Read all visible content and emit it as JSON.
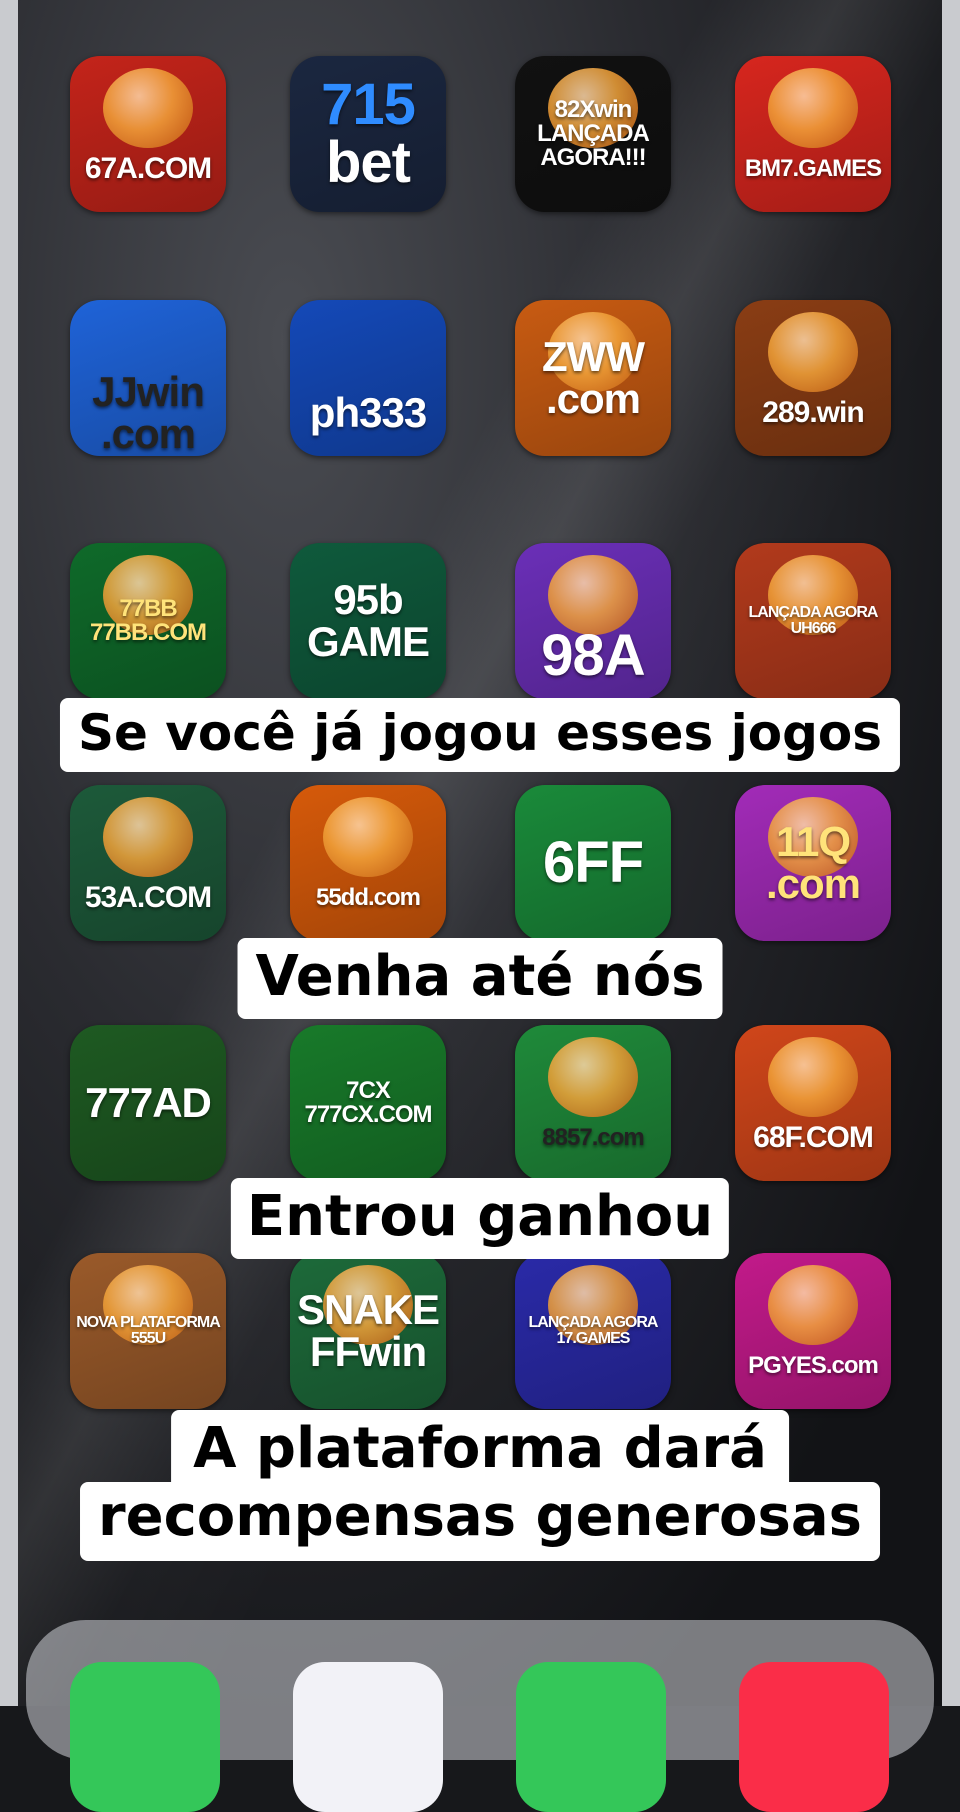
{
  "apps": [
    {
      "name": "67A.COM",
      "label": "67A.COM",
      "bg": "#c4241a",
      "fg": "#ffffff"
    },
    {
      "name": "715 bet",
      "label": "715\nbet",
      "bg": "#1b2740",
      "fg": "#ffffff",
      "accent": "#2f8cff"
    },
    {
      "name": "82Xwin",
      "label": "82Xwin\nLANÇADA\nAGORA!!!",
      "bg": "#111111",
      "fg": "#ffffff"
    },
    {
      "name": "BM7.GAMES",
      "label": "BM7.GAMES",
      "bg": "#d7261e",
      "fg": "#ffffff"
    },
    {
      "name": "JJwin",
      "label": "JJwin\n.com",
      "bg": "#1f63d8",
      "fg": "#222222"
    },
    {
      "name": "ph333",
      "label": "ph333",
      "bg": "#1449b8",
      "fg": "#ffffff"
    },
    {
      "name": "ZWW.com",
      "label": "ZWW\n.com",
      "bg": "#c85b12",
      "fg": "#ffffff"
    },
    {
      "name": "289.win",
      "label": "289.win",
      "bg": "#8a3d14",
      "fg": "#ffffff"
    },
    {
      "name": "77BB",
      "label": "77BB\n77BB.COM",
      "bg": "#0f6a2a",
      "fg": "#ffe37a"
    },
    {
      "name": "95b GAME",
      "label": "95b\nGAME",
      "bg": "#0f5a3c",
      "fg": "#ffffff"
    },
    {
      "name": "98A",
      "label": "98A",
      "bg": "#6b2fb8",
      "fg": "#ffffff"
    },
    {
      "name": "UH666",
      "label": "LANÇADA AGORA\nUH666",
      "bg": "#b23a1c",
      "fg": "#ffffff"
    },
    {
      "name": "53A.COM",
      "label": "53A.COM",
      "bg": "#1d5a3a",
      "fg": "#ffffff"
    },
    {
      "name": "55dd.com",
      "label": "55dd.com",
      "bg": "#d65a0a",
      "fg": "#ffffff"
    },
    {
      "name": "6FF",
      "label": "6FF",
      "bg": "#1a8a3a",
      "fg": "#ffffff"
    },
    {
      "name": "11Q.com",
      "label": "11Q\n.com",
      "bg": "#a22bb8",
      "fg": "#ffe37a"
    },
    {
      "name": "777AD",
      "label": "777AD",
      "bg": "#1e5a22",
      "fg": "#ffffff"
    },
    {
      "name": "777CX.COM",
      "label": "7CX\n777CX.COM",
      "bg": "#187a2a",
      "fg": "#ffffff"
    },
    {
      "name": "8857.com",
      "label": "8857.com",
      "bg": "#1f8a3a",
      "fg": "#222222"
    },
    {
      "name": "68F.COM",
      "label": "68F.COM",
      "bg": "#d0461a",
      "fg": "#ffffff"
    },
    {
      "name": "555U",
      "label": "NOVA PLATAFORMA\n555U",
      "bg": "#9a5a2a",
      "fg": "#ffffff"
    },
    {
      "name": "FFwin",
      "label": "SNAKE\nFFwin",
      "bg": "#1d6a3a",
      "fg": "#ffffff"
    },
    {
      "name": "17.GAMES",
      "label": "LANÇADA AGORA\n17.GAMES",
      "bg": "#2a2aa8",
      "fg": "#ffffff"
    },
    {
      "name": "PGYES.com",
      "label": "PGYES.com",
      "bg": "#c21a8a",
      "fg": "#ffffff"
    }
  ],
  "captions": {
    "line1": "Se você já jogou esses jogos",
    "line2": "Venha até nós",
    "line3": "Entrou ganhou",
    "line4a": "A plataforma dará",
    "line4b": "recompensas generosas"
  },
  "dock": [
    {
      "name": "phone",
      "color": "#34c759"
    },
    {
      "name": "safari",
      "color": "#f2f2f7"
    },
    {
      "name": "messages",
      "color": "#34c759"
    },
    {
      "name": "music",
      "color": "#fa2d48"
    }
  ]
}
